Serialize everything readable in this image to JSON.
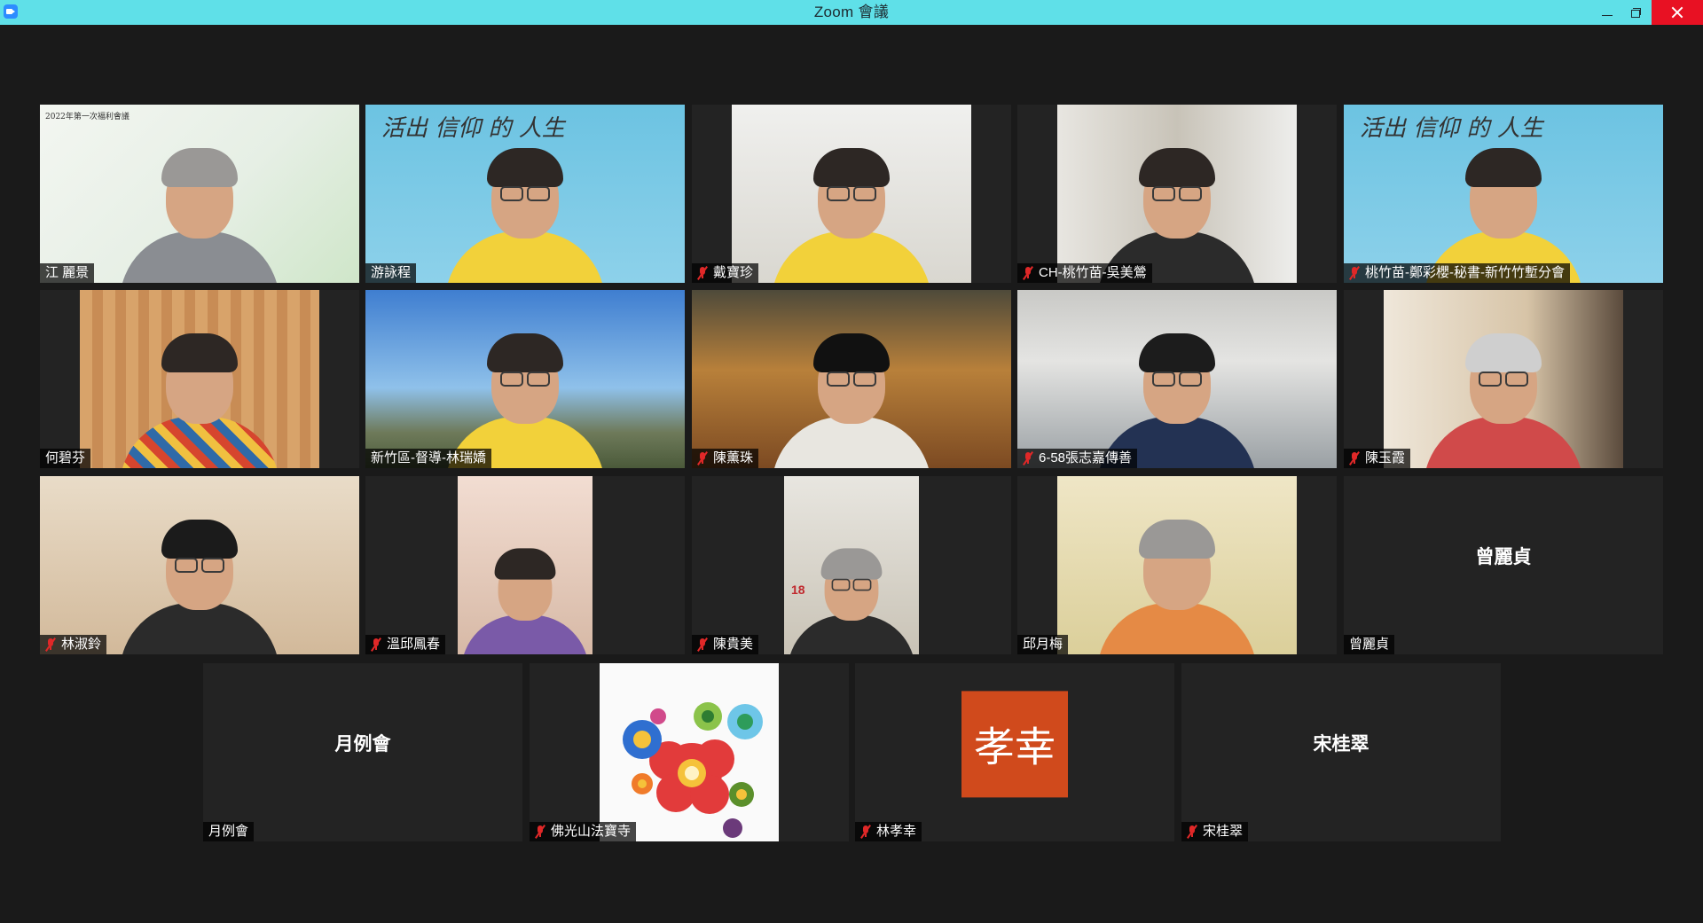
{
  "window": {
    "title": "Zoom 會議",
    "controls": {
      "minimize": "minimize",
      "maximize": "restore",
      "close": "close"
    }
  },
  "participants": [
    {
      "name": "江 麗景",
      "muted": false
    },
    {
      "name": "游詠程",
      "muted": false
    },
    {
      "name": "戴寶珍",
      "muted": true
    },
    {
      "name": "CH-桃竹苗-吳美鶯",
      "muted": true
    },
    {
      "name": "桃竹苗-鄭彩櫻-秘書-新竹竹塹分會",
      "muted": true
    },
    {
      "name": "何碧芬",
      "muted": false
    },
    {
      "name": "新竹區-督導-林瑞嬌",
      "muted": false,
      "active_speaker": true
    },
    {
      "name": "陳薰珠",
      "muted": true
    },
    {
      "name": "6-58張志嘉傳善",
      "muted": true
    },
    {
      "name": "陳玉霞",
      "muted": true
    },
    {
      "name": "林淑鈴",
      "muted": true
    },
    {
      "name": "溫邱鳳春",
      "muted": true
    },
    {
      "name": "陳貴美",
      "muted": true
    },
    {
      "name": "邱月梅",
      "muted": false
    },
    {
      "name": "曾麗貞",
      "muted": false,
      "display_name": "曾麗貞"
    },
    {
      "name": "月例會",
      "muted": false,
      "display_name": "月例會"
    },
    {
      "name": "佛光山法寶寺",
      "muted": true
    },
    {
      "name": "林孝幸",
      "muted": true,
      "avatar_text": "孝幸",
      "avatar_color": "#d04a1c"
    },
    {
      "name": "宋桂翠",
      "muted": true,
      "display_name": "宋桂翠"
    }
  ],
  "tile_text": {
    "banner_0": "2022年第一次福利會議",
    "calli_1": "活出 信仰 的 人生",
    "calli_4": "活出 信仰 的 人生",
    "calendar_12": "18"
  },
  "colors": {
    "titlebar": "#5fe0e8",
    "background": "#1a1a1a",
    "tile": "#232323",
    "active_border": "#d8ef3a",
    "muted_icon": "#e02828",
    "close_button": "#e81123"
  }
}
